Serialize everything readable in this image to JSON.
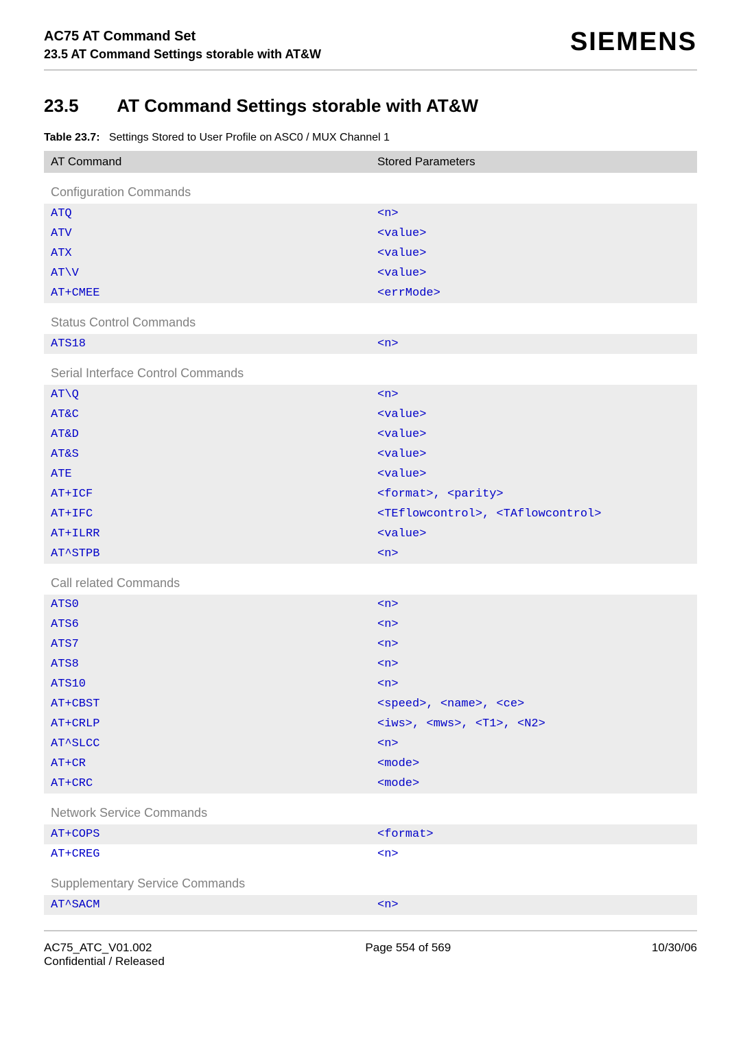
{
  "header": {
    "title": "AC75 AT Command Set",
    "sub": "23.5 AT Command Settings storable with AT&W",
    "logo": "SIEMENS"
  },
  "section": {
    "number": "23.5",
    "title": "AT Command Settings storable with AT&W"
  },
  "table": {
    "caption_bold": "Table 23.7:",
    "caption_rest": "Settings Stored to User Profile on ASC0 / MUX Channel 1",
    "head_cmd": "AT Command",
    "head_param": "Stored Parameters"
  },
  "groups": [
    {
      "label": "Configuration Commands",
      "rows": [
        {
          "cmd": "ATQ",
          "param": "<n>"
        },
        {
          "cmd": "ATV",
          "param": "<value>"
        },
        {
          "cmd": "ATX",
          "param": "<value>"
        },
        {
          "cmd": "AT\\V",
          "param": "<value>"
        },
        {
          "cmd": "AT+CMEE",
          "param": "<errMode>"
        }
      ]
    },
    {
      "label": "Status Control Commands",
      "rows": [
        {
          "cmd": "ATS18",
          "param": "<n>"
        }
      ]
    },
    {
      "label": "Serial Interface Control Commands",
      "rows": [
        {
          "cmd": "AT\\Q",
          "param": "<n>"
        },
        {
          "cmd": "AT&C",
          "param": "<value>"
        },
        {
          "cmd": "AT&D",
          "param": "<value>"
        },
        {
          "cmd": "AT&S",
          "param": "<value>"
        },
        {
          "cmd": "ATE",
          "param": "<value>"
        },
        {
          "cmd": "AT+ICF",
          "param": "<format>, <parity>"
        },
        {
          "cmd": "AT+IFC",
          "param": "<TEflowcontrol>, <TAflowcontrol>"
        },
        {
          "cmd": "AT+ILRR",
          "param": "<value>"
        },
        {
          "cmd": "AT^STPB",
          "param": "<n>"
        }
      ]
    },
    {
      "label": "Call related Commands",
      "rows": [
        {
          "cmd": "ATS0",
          "param": "<n>"
        },
        {
          "cmd": "ATS6",
          "param": "<n>"
        },
        {
          "cmd": "ATS7",
          "param": "<n>"
        },
        {
          "cmd": "ATS8",
          "param": "<n>"
        },
        {
          "cmd": "ATS10",
          "param": "<n>"
        },
        {
          "cmd": "AT+CBST",
          "param": "<speed>, <name>, <ce>"
        },
        {
          "cmd": "AT+CRLP",
          "param": "<iws>, <mws>, <T1>, <N2>"
        },
        {
          "cmd": "AT^SLCC",
          "param": "<n>"
        },
        {
          "cmd": "AT+CR",
          "param": "<mode>"
        },
        {
          "cmd": "AT+CRC",
          "param": "<mode>"
        }
      ]
    },
    {
      "label": "Network Service Commands",
      "rows": [
        {
          "cmd": "AT+COPS",
          "param": "<format>"
        },
        {
          "cmd": "AT+CREG",
          "param": "<n>"
        }
      ]
    },
    {
      "label": "Supplementary Service Commands",
      "rows": [
        {
          "cmd": "AT^SACM",
          "param": "<n>"
        }
      ]
    }
  ],
  "footer": {
    "left1": "AC75_ATC_V01.002",
    "left2": "Confidential / Released",
    "center": "Page 554 of 569",
    "right": "10/30/06"
  }
}
